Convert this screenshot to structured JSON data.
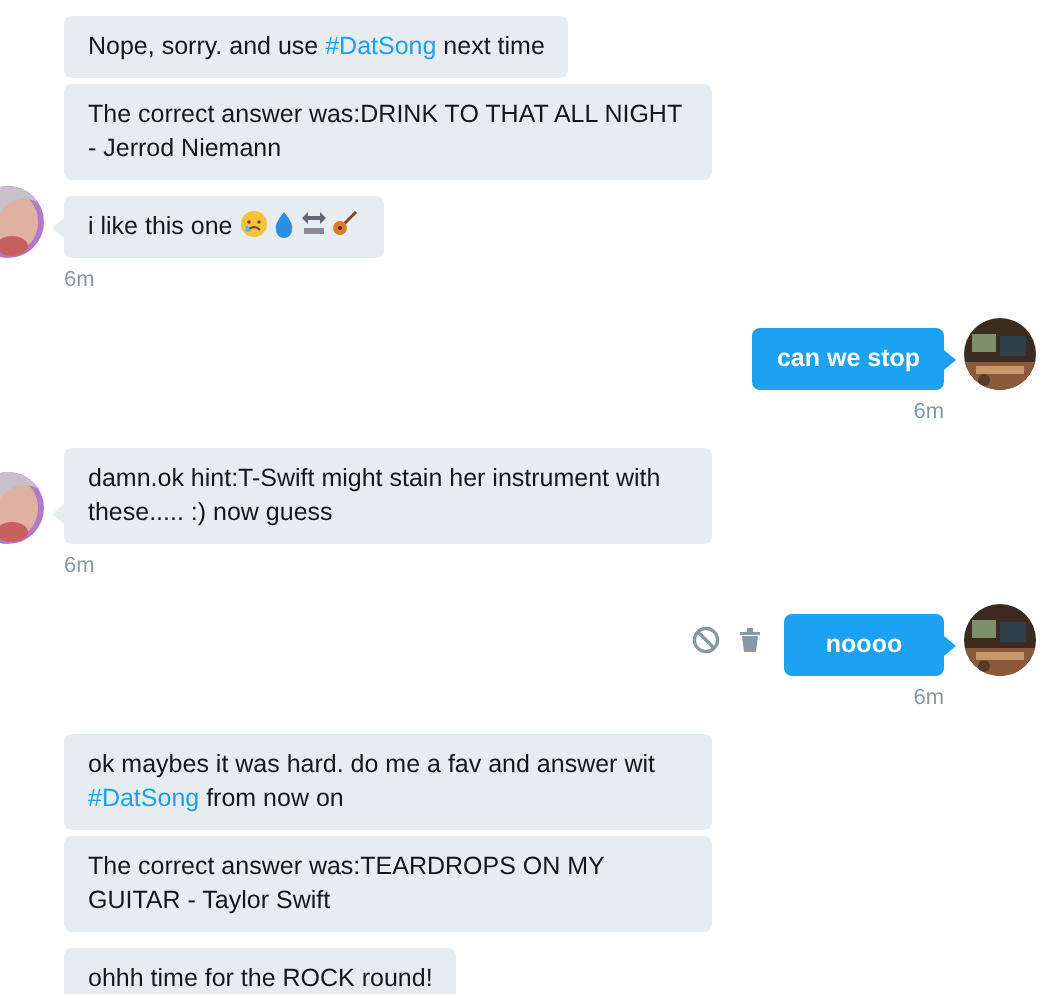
{
  "messages": [
    {
      "kind": "incoming",
      "bubbles": [
        {
          "parts": [
            {
              "kind": "text",
              "text": "Nope, sorry.  and use "
            },
            {
              "kind": "hashtag",
              "text": "#DatSong"
            },
            {
              "kind": "text",
              "text": " next time"
            }
          ]
        },
        {
          "parts": [
            {
              "kind": "text",
              "text": "The correct answer was:DRINK TO THAT ALL NIGHT - Jerrod Niemann"
            }
          ]
        },
        {
          "parts": [
            {
              "kind": "text",
              "text": "i like this one "
            },
            {
              "kind": "crying-face"
            },
            {
              "kind": "droplet"
            },
            {
              "kind": "arrow"
            },
            {
              "kind": "guitar"
            }
          ]
        }
      ],
      "time": "6m"
    },
    {
      "kind": "outgoing",
      "bubbles": [
        {
          "parts": [
            {
              "kind": "text",
              "text": "can we stop"
            }
          ]
        }
      ],
      "time": "6m",
      "actions": false
    },
    {
      "kind": "incoming",
      "bubbles": [
        {
          "parts": [
            {
              "kind": "text",
              "text": "damn.ok hint:T-Swift might stain her instrument with these..... :) now guess"
            }
          ]
        }
      ],
      "time": "6m"
    },
    {
      "kind": "outgoing",
      "bubbles": [
        {
          "parts": [
            {
              "kind": "text",
              "text": "noooo"
            }
          ]
        }
      ],
      "time": "6m",
      "actions": true
    },
    {
      "kind": "incoming",
      "bubbles": [
        {
          "parts": [
            {
              "kind": "text",
              "text": "ok maybes it was hard. do me a fav and answer wit "
            },
            {
              "kind": "hashtag",
              "text": "#DatSong"
            },
            {
              "kind": "text",
              "text": " from now on"
            }
          ]
        },
        {
          "parts": [
            {
              "kind": "text",
              "text": "The correct answer was:TEARDROPS ON MY GUITAR - Taylor Swift"
            }
          ]
        },
        {
          "parts": [
            {
              "kind": "text",
              "text": "ohhh time for the ROCK round!"
            }
          ]
        }
      ]
    }
  ]
}
